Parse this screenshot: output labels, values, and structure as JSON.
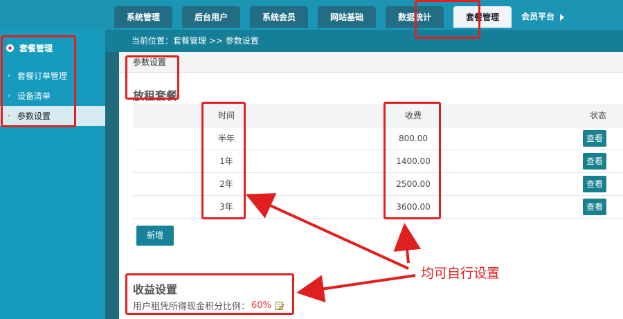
{
  "topnav": {
    "tabs": [
      "系统管理",
      "后台用户",
      "系统会员",
      "网站基础",
      "数据统计",
      "套餐管理"
    ],
    "active_index": 5,
    "member_platform": "会员平台"
  },
  "sidebar": {
    "title": "套餐管理",
    "items": [
      {
        "label": "套餐订单管理",
        "active": false
      },
      {
        "label": "设备清单",
        "active": false
      },
      {
        "label": "参数设置",
        "active": true
      }
    ]
  },
  "breadcrumb": "当前位置：套餐管理 >> 参数设置",
  "page": {
    "subheader": "参数设置",
    "section_title": "放租套餐",
    "table": {
      "headers": {
        "time": "时间",
        "fee": "收费",
        "status": "状态"
      },
      "rows": [
        {
          "time": "半年",
          "fee": "800.00",
          "action": "查看"
        },
        {
          "time": "1年",
          "fee": "1400.00",
          "action": "查看"
        },
        {
          "time": "2年",
          "fee": "2500.00",
          "action": "查看"
        },
        {
          "time": "3年",
          "fee": "3600.00",
          "action": "查看"
        }
      ]
    },
    "add_button": "新增",
    "income": {
      "title": "收益设置",
      "label": "用户租凭所得现金积分比例：",
      "value": "60%"
    }
  },
  "annotation": {
    "text": "均可自行设置",
    "color": "#e02020"
  },
  "icons": {
    "radio": "radio-dot-icon",
    "chevron": "chevron-right-icon",
    "edit": "edit-pencil-icon",
    "play": "triangle-right-icon"
  }
}
